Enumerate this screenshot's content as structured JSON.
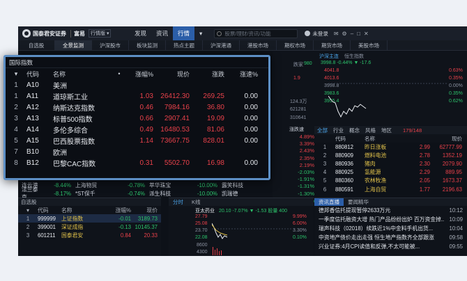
{
  "app": {
    "logo_text": "国泰君安证券",
    "logo_sub": "富易",
    "version": "行情版 ▾",
    "nav": [
      "发现",
      "资讯",
      "行情"
    ],
    "active_nav": "行情",
    "search_placeholder": "股票/理财/资讯/功能",
    "user": "未登录",
    "icons": [
      "mail-icon",
      "gear-icon",
      "minimize-icon",
      "restore-icon",
      "close-icon"
    ]
  },
  "tabs": [
    "自选股",
    "全景监测",
    "沪深股市",
    "板块监测",
    "热点主题",
    "沪深港通",
    "港股市场",
    "期权市场",
    "期货市场",
    "美股市场"
  ],
  "active_tab": "全景监测",
  "background": {
    "index_label": "沪深主连",
    "index_label2": "恒生指数",
    "index_value": "3998.8 -0.44% ▼ -17.6",
    "right_scale": [
      "4041.8",
      "4013.6",
      "3998.8",
      "3983.6",
      "3955.4"
    ],
    "right_pct": [
      "0.63%",
      "0.35%",
      "0.00%",
      "0.35%",
      "0.62%"
    ],
    "vol_labels": [
      "1.9",
      "124.3万",
      "621281",
      "310641"
    ],
    "bg_text": "跌家",
    "bg_num": "980",
    "top_speed": "涨跌速",
    "mid_tabs": [
      "全部",
      "行业",
      "概念",
      "风格",
      "地区"
    ],
    "mid_count": "179/148",
    "mid_head": [
      "代码",
      "名称",
      "现价"
    ],
    "sector_rows": [
      {
        "idx": "1",
        "code": "880812",
        "name": "昨日涨板",
        "pct": "2.99",
        "price": "62777.99"
      },
      {
        "idx": "2",
        "code": "880909",
        "name": "燃料电池",
        "pct": "2.78",
        "price": "1352.19"
      },
      {
        "idx": "3",
        "code": "880936",
        "name": "猪肉",
        "pct": "2.30",
        "price": "2079.90"
      },
      {
        "idx": "4",
        "code": "880925",
        "name": "氢能源",
        "pct": "2.29",
        "price": "889.95"
      },
      {
        "idx": "5",
        "code": "880360",
        "name": "农林牧渔",
        "pct": "2.05",
        "price": "1673.37"
      },
      {
        "idx": "6",
        "code": "880591",
        "name": "上海自贸",
        "pct": "1.77",
        "price": "2196.63"
      }
    ],
    "speed_col": [
      "4.89%",
      "3.39%",
      "2.43%",
      "2.35%",
      "2.19%",
      "-2.03%",
      "-1.91%",
      "-1.31%",
      "-1.30%",
      "-1.29%"
    ],
    "speed_rows": [
      {
        "name1": "连云港",
        "v1": "-8.44%",
        "name2": "上海物贸",
        "v2": "-0.78%",
        "name3": "萃华珠宝",
        "v3": "-10.00%",
        "name4": "露笑科技"
      },
      {
        "name1": "法兰泰克",
        "v1": "-8.17%",
        "name2": "*ST保千",
        "v2": "-0.74%",
        "name3": "派生科技",
        "v3": "-10.00%",
        "name4": "凯瑞德"
      }
    ],
    "self_title": "自选股",
    "self_head": [
      "代码",
      "名称",
      "涨幅%",
      "现价"
    ],
    "self_rows": [
      {
        "idx": "1",
        "code": "999999",
        "name": "上证指数",
        "pct": "-0.01",
        "price": "3189.73"
      },
      {
        "idx": "2",
        "code": "399001",
        "name": "深证成指",
        "pct": "-0.13",
        "price": "10145.37"
      },
      {
        "idx": "3",
        "code": "601211",
        "name": "国泰君安",
        "pct": "0.84",
        "price": "20.33"
      }
    ],
    "chart_tabs": [
      "分时",
      "K线"
    ],
    "chart_title": "亚太药业",
    "chart_info": "20.10 -7.07% ▼ -1.53 股量 400",
    "chart_scale": [
      "27.79",
      "25.08",
      "23.70",
      "22.08",
      "8600",
      "4300"
    ],
    "chart_pct": [
      "9.99%",
      "6.00%",
      "3.30%",
      "0.10%"
    ],
    "news_tabs": [
      "资讯直播",
      "要闻精华"
    ],
    "news": [
      {
        "text": "德邦香信托提现暂停2633万元",
        "time": "10:12"
      },
      {
        "text": "一季度信托融资大增 热门产品纷纷出炉 百万资金掉...",
        "time": "10:09"
      },
      {
        "text": "瑞声科技（02018）续跌近1%中金料手机出货...",
        "time": "10:04"
      },
      {
        "text": "中资地产债价走出走强 恒生地产指数齐全部跟涨",
        "time": "09:58"
      },
      {
        "text": "兴业证券:4月CPI读值和反弹,不太可能被...",
        "time": "09:55"
      }
    ]
  },
  "overlay": {
    "title": "国际指数",
    "head": [
      "代码",
      "名称",
      "•",
      "涨幅%",
      "现价",
      "涨跌",
      "涨速%"
    ],
    "head_icon": "sort-down-icon",
    "rows": [
      {
        "idx": "1",
        "code": "A10",
        "name": "美洲",
        "pct": "",
        "price": "",
        "chg": "",
        "spd": ""
      },
      {
        "idx": "1",
        "code": "A11",
        "name": "道琼斯工业",
        "pct": "1.03",
        "price": "26412.30",
        "chg": "269.25",
        "spd": "0.00"
      },
      {
        "idx": "2",
        "code": "A12",
        "name": "纳斯达克指数",
        "pct": "0.46",
        "price": "7984.16",
        "chg": "36.80",
        "spd": "0.00"
      },
      {
        "idx": "3",
        "code": "A13",
        "name": "标普500指数",
        "pct": "0.66",
        "price": "2907.41",
        "chg": "19.09",
        "spd": "0.00"
      },
      {
        "idx": "4",
        "code": "A14",
        "name": "多伦多综合",
        "pct": "0.49",
        "price": "16480.53",
        "chg": "81.06",
        "spd": "0.00"
      },
      {
        "idx": "5",
        "code": "A15",
        "name": "巴西股票指数",
        "pct": "1.14",
        "price": "73667.75",
        "chg": "828.01",
        "spd": "0.00"
      },
      {
        "idx": "7",
        "code": "B10",
        "name": "欧洲",
        "pct": "",
        "price": "",
        "chg": "",
        "spd": ""
      },
      {
        "idx": "8",
        "code": "B12",
        "name": "巴黎CAC指数",
        "pct": "0.31",
        "price": "5502.70",
        "chg": "16.98",
        "spd": "0.00"
      }
    ]
  },
  "colors": {
    "up": "#e8414a",
    "down": "#2cc36b",
    "accent": "#2b5ea8",
    "border": "#5d8fc5"
  }
}
